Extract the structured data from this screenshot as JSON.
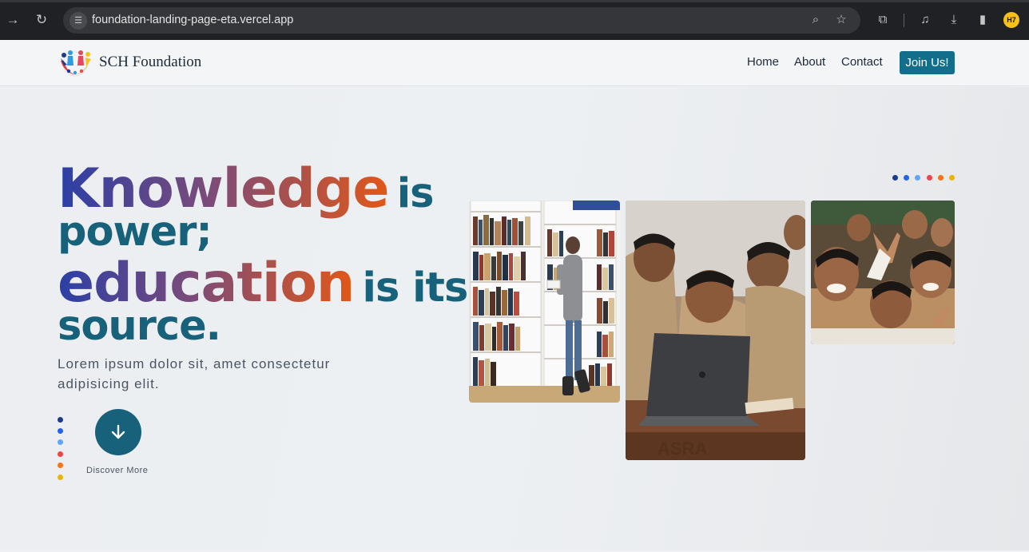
{
  "browser": {
    "url": "foundation-landing-page-eta.vercel.app",
    "profile_initials": "H7"
  },
  "site": {
    "brand": "SCH Foundation",
    "nav": [
      "Home",
      "About",
      "Contact"
    ],
    "cta": "Join Us!"
  },
  "hero": {
    "headline": {
      "word1": "Knowledge",
      "text1": "is",
      "text2": "power;",
      "word2": "education",
      "text3": "is its",
      "text4": "source."
    },
    "lead": "Lorem ipsum dolor sit, amet consectetur adipisicing elit.",
    "discover_label": "Discover More"
  },
  "colors": {
    "primary": "#17627a",
    "cta": "#126e8a",
    "gradient": [
      "#2b3fa6",
      "#7a4b7a",
      "#e25718"
    ],
    "dots": [
      "#1e3a8a",
      "#2563eb",
      "#60a5fa",
      "#ef4444",
      "#f97316",
      "#eab308"
    ]
  },
  "images": [
    {
      "name": "library-photo",
      "alt": "Woman reading among library bookshelves"
    },
    {
      "name": "laptop-photo",
      "alt": "Schoolchildren gathered around a laptop"
    },
    {
      "name": "kids-photo",
      "alt": "Group of smiling schoolchildren"
    }
  ]
}
